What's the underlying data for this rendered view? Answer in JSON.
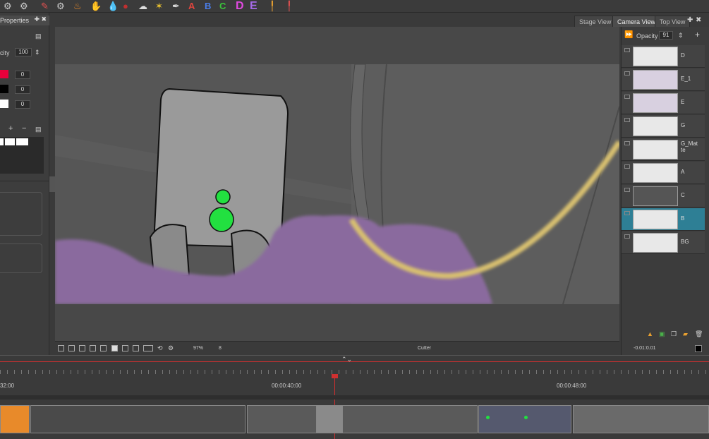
{
  "toolbar": {
    "icons": [
      "gear-icon",
      "gear-icon",
      "pencil-tool-icon",
      "gear-icon",
      "paint-icon",
      "hand-icon",
      "drop-icon",
      "drop-red-icon",
      "cloud-icon",
      "sparkle-icon",
      "pen-icon"
    ],
    "letters": [
      {
        "text": "A",
        "color": "#e0453e"
      },
      {
        "text": "B",
        "color": "#4a7de8"
      },
      {
        "text": "C",
        "color": "#3ac43a"
      },
      {
        "text": "D",
        "color": "#e04ae0"
      },
      {
        "text": "E",
        "color": "#a56ae8"
      }
    ]
  },
  "properties": {
    "title": "Properties",
    "opacity_label": "city",
    "opacity_value": "100",
    "colors": [
      {
        "color": "#e8003b",
        "value": "0"
      },
      {
        "color": "#000000",
        "value": "0"
      },
      {
        "color": "#ffffff",
        "value": "0"
      }
    ]
  },
  "tabs": [
    "Stage View",
    "Camera View",
    "Top View"
  ],
  "layers_panel": {
    "opacity_label": "Opacity",
    "opacity_value": "91",
    "layers": [
      {
        "name": "D",
        "selected": false
      },
      {
        "name": "E_1",
        "selected": false
      },
      {
        "name": "E",
        "selected": false
      },
      {
        "name": "G",
        "selected": false
      },
      {
        "name": "G_Matte",
        "selected": false
      },
      {
        "name": "A",
        "selected": false
      },
      {
        "name": "C",
        "selected": false
      },
      {
        "name": "B",
        "selected": true
      },
      {
        "name": "BG",
        "selected": false
      }
    ]
  },
  "bottombar": {
    "zoom": "97%",
    "frame": "8",
    "tool": "Cutter",
    "timecode": "-0.01:0.01"
  },
  "timeline": {
    "ticks": [
      "32:00",
      "00:00:40:00",
      "00:00:48:00"
    ]
  },
  "colors": {
    "accent": "#2e7f95",
    "playhead": "#d03030",
    "orange": "#e88a2a",
    "purple": "#8a6a9e",
    "green": "#22e040"
  }
}
